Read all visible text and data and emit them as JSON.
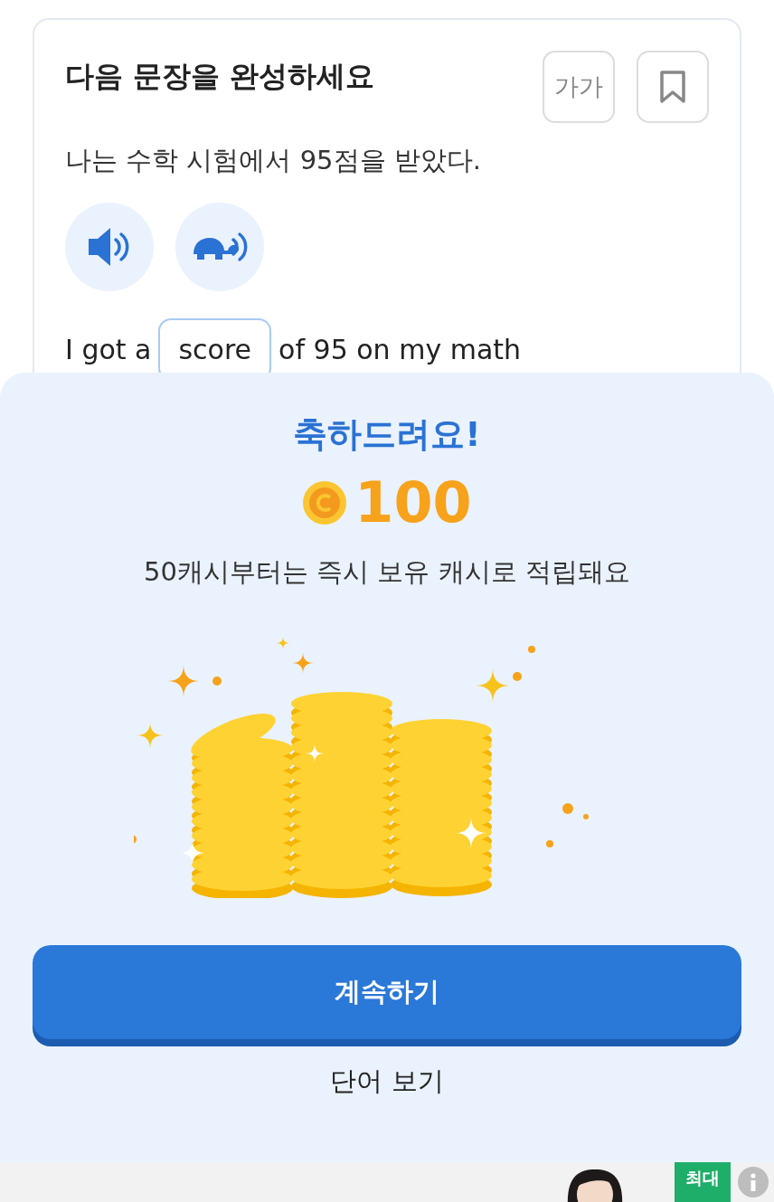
{
  "question": {
    "title": "다음 문장을 완성하세요",
    "font_button": "가가",
    "korean_sentence": "나는 수학 시험에서 95점을 받았다.",
    "english_sentence": {
      "before": "I got a",
      "blank": "score",
      "after": "of 95 on my math"
    }
  },
  "reward_sheet": {
    "title": "축하드려요!",
    "amount": "100",
    "message": "50캐시부터는 즉시 보유 캐시로 적립돼요",
    "primary_button": "계속하기",
    "secondary_button": "단어 보기"
  },
  "ad": {
    "badge": "최대"
  }
}
